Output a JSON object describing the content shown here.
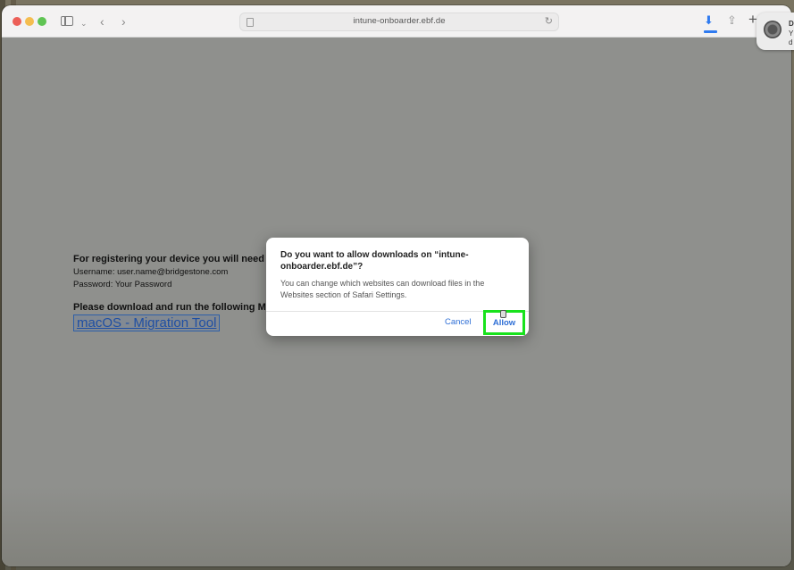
{
  "browser": {
    "url": "intune-onboarder.ebf.de"
  },
  "page": {
    "reg_heading": "For registering your device you will need",
    "username_line": "Username: user.name@bridgestone.com",
    "password_line": "Password: Your Password",
    "download_heading": "Please download and run the following M",
    "tool_link": "macOS - Migration Tool"
  },
  "dialog": {
    "title": "Do you want to allow downloads on “intune-onboarder.ebf.de”?",
    "message": "You can change which websites can download files in the Websites section of Safari Settings.",
    "cancel_label": "Cancel",
    "allow_label": "Allow"
  },
  "notification": {
    "line1": "D",
    "line2": "Y",
    "line3": "d"
  },
  "colors": {
    "highlight": "#18e21c",
    "link": "#2f6fd6"
  }
}
